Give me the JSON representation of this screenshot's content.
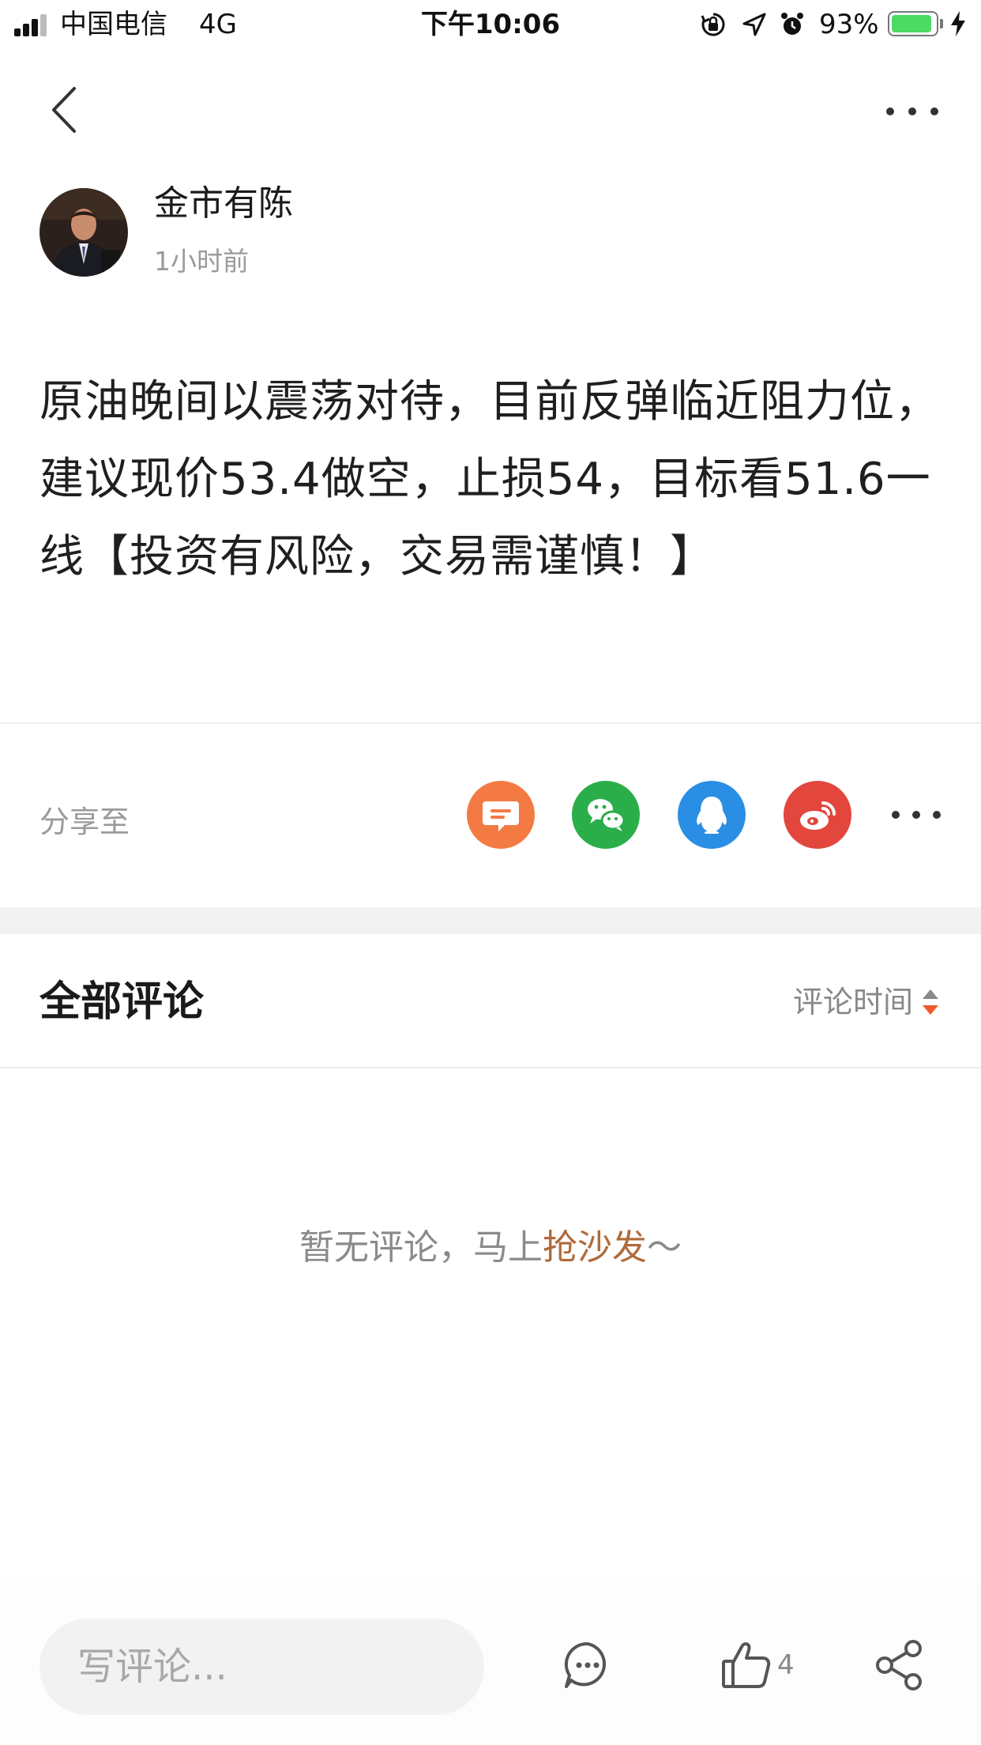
{
  "status_bar": {
    "carrier": "中国电信",
    "network": "4G",
    "time": "下午10:06",
    "battery_percent": "93%",
    "battery_level": 0.93,
    "icons": [
      "signal-bars-icon",
      "rotation-lock-icon",
      "location-arrow-icon",
      "alarm-clock-icon",
      "battery-icon",
      "charging-bolt-icon"
    ]
  },
  "nav": {
    "back_icon": "chevron-left-icon",
    "more_icon": "more-horizontal-icon"
  },
  "author": {
    "name": "金市有陈",
    "time": "1小时前"
  },
  "post": {
    "text": "原油晚间以震荡对待，目前反弹临近阻力位，建议现价53.4做空，止损54，目标看51.6一线【投资有风险，交易需谨慎！】"
  },
  "share": {
    "label": "分享至",
    "targets": [
      {
        "name": "message",
        "icon": "chat-bubble-icon",
        "color": "#f47a44"
      },
      {
        "name": "wechat",
        "icon": "wechat-icon",
        "color": "#2aae4a"
      },
      {
        "name": "qq",
        "icon": "qq-penguin-icon",
        "color": "#2a8ee5"
      },
      {
        "name": "weibo",
        "icon": "weibo-icon",
        "color": "#e2463d"
      }
    ],
    "more_icon": "more-horizontal-icon"
  },
  "comments": {
    "title": "全部评论",
    "sort_label": "评论时间",
    "sort_icon": "sort-updown-icon",
    "empty_prefix": "暂无评论，马上",
    "empty_link": "抢沙发",
    "empty_suffix": "～"
  },
  "bottom_bar": {
    "input_placeholder": "写评论...",
    "comment_icon": "comment-bubble-icon",
    "like_icon": "thumbs-up-icon",
    "like_count": "4",
    "share_icon": "share-icon"
  },
  "colors": {
    "accent_link": "#b06a3b",
    "sort_arrow_up": "#888888",
    "sort_arrow_down": "#f05a28",
    "battery_green": "#4cd964"
  }
}
